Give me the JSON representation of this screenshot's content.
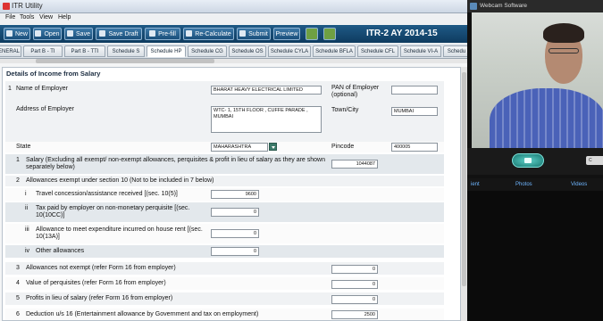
{
  "window": {
    "title": "ITR Utility"
  },
  "menu": [
    "File",
    "Tools",
    "View",
    "Help"
  ],
  "toolbar": {
    "buttons": [
      "New",
      "Open",
      "Save",
      "Save Draft",
      "Pre-fill",
      "Re-Calculate",
      "Submit",
      "Preview"
    ],
    "form_title": "ITR-2   AY 2014-15"
  },
  "tabs": [
    "ENERAL",
    "Part B - TI",
    "Part B - TTI",
    "Schedule S",
    "Schedule HP",
    "Schedule CG",
    "Schedule OS",
    "Schedule CYLA",
    "Schedule BFLA",
    "Schedule CFL",
    "Schedule VI-A",
    "Schedu"
  ],
  "active_tab": "Schedule HP",
  "section": {
    "heading": "Details of Income from Salary",
    "employer": {
      "num": "1",
      "name_label": "Name of Employer",
      "name_value": "BHARAT HEAVY ELECTRICAL LIMITED",
      "pan_label": "PAN of Employer (optional)",
      "pan_value": "",
      "address_label": "Address of Employer",
      "address_value": "WTC- 1, 15TH FLOOR , CUFFE PARADE , MUMBAI",
      "town_label": "Town/City",
      "town_value": "MUMBAI",
      "state_label": "State",
      "state_value": "MAHARASHTRA",
      "pincode_label": "Pincode",
      "pincode_value": "400005"
    },
    "rows": {
      "salary": {
        "num": "1",
        "label": "Salary (Excluding all exempt/ non-exempt allowances, perquisites & profit in lieu of salary as they are shown separately below)",
        "value": "1044087"
      },
      "allowances_exempt": {
        "num": "2",
        "label": "Allowances exempt under section 10 (Not to be included in 7 below)"
      },
      "sub_i": {
        "num": "i",
        "label": "Travel concession/assistance received [(sec. 10(5)]",
        "value": "9600"
      },
      "sub_ii": {
        "num": "ii",
        "label": "Tax paid by employer on non-monetary perquisite [(sec. 10(10CC)]",
        "value": "0"
      },
      "sub_iii": {
        "num": "iii",
        "label": "Allowance to meet expenditure incurred on house rent [(sec. 10(13A)]",
        "value": "0"
      },
      "sub_iv": {
        "num": "iv",
        "label": "Other allowances",
        "value": "0"
      },
      "not_exempt": {
        "num": "3",
        "label": "Allowances not exempt (refer Form 16 from employer)",
        "value": "0"
      },
      "perquisites": {
        "num": "4",
        "label": "Value of perquisites (refer Form 16 from employer)",
        "value": "0"
      },
      "profits": {
        "num": "5",
        "label": "Profits in lieu of salary (refer Form 16 from employer)",
        "value": "0"
      },
      "deduction": {
        "num": "6",
        "label": "Deduction u/s 16 (Entertainment allowance by Government and tax on employment)",
        "value": "2500"
      }
    }
  },
  "webcam": {
    "title": "Webcam Software",
    "side_button": "C",
    "tabs": [
      "ient",
      "Photos",
      "Videos"
    ]
  }
}
